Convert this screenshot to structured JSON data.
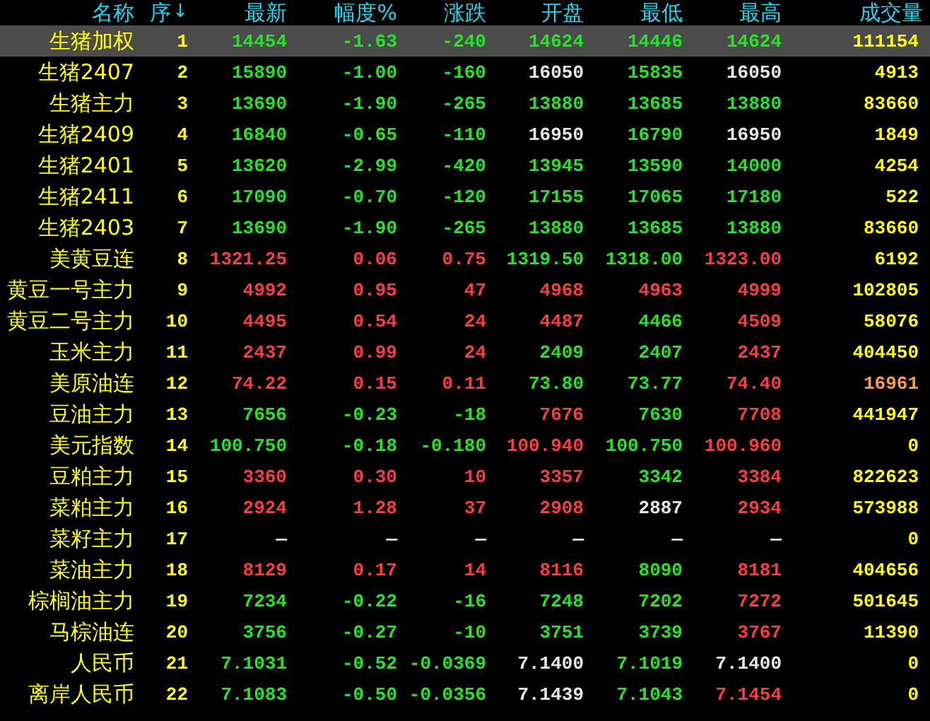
{
  "table": {
    "columns": [
      {
        "label": "名称"
      },
      {
        "label": "序",
        "sort_mark": "↓"
      },
      {
        "label": "最新"
      },
      {
        "label": "幅度%"
      },
      {
        "label": "涨跌"
      },
      {
        "label": "开盘"
      },
      {
        "label": "最低"
      },
      {
        "label": "最高"
      },
      {
        "label": "成交量"
      }
    ],
    "rows": [
      {
        "selected": true,
        "cells": [
          {
            "text": "生猪加权",
            "color": "#ffff00"
          },
          {
            "text": "1",
            "color": "#ffff00"
          },
          {
            "text": "14454",
            "color": "#22e622"
          },
          {
            "text": "-1.63",
            "color": "#22e622"
          },
          {
            "text": "-240",
            "color": "#22e622"
          },
          {
            "text": "14624",
            "color": "#22e622"
          },
          {
            "text": "14446",
            "color": "#22e622"
          },
          {
            "text": "14624",
            "color": "#22e622"
          },
          {
            "text": "111154",
            "color": "#ffff00"
          }
        ]
      },
      {
        "selected": false,
        "cells": [
          {
            "text": "生猪2407",
            "color": "#ffff00"
          },
          {
            "text": "2",
            "color": "#ffff00"
          },
          {
            "text": "15890",
            "color": "#22e622"
          },
          {
            "text": "-1.00",
            "color": "#22e622"
          },
          {
            "text": "-160",
            "color": "#22e622"
          },
          {
            "text": "16050",
            "color": "#e6e6e6"
          },
          {
            "text": "15835",
            "color": "#22e622"
          },
          {
            "text": "16050",
            "color": "#e6e6e6"
          },
          {
            "text": "4913",
            "color": "#ffff00"
          }
        ]
      },
      {
        "selected": false,
        "cells": [
          {
            "text": "生猪主力",
            "color": "#ffff00"
          },
          {
            "text": "3",
            "color": "#ffff00"
          },
          {
            "text": "13690",
            "color": "#22e622"
          },
          {
            "text": "-1.90",
            "color": "#22e622"
          },
          {
            "text": "-265",
            "color": "#22e622"
          },
          {
            "text": "13880",
            "color": "#22e622"
          },
          {
            "text": "13685",
            "color": "#22e622"
          },
          {
            "text": "13880",
            "color": "#22e622"
          },
          {
            "text": "83660",
            "color": "#ffff00"
          }
        ]
      },
      {
        "selected": false,
        "cells": [
          {
            "text": "生猪2409",
            "color": "#ffff00"
          },
          {
            "text": "4",
            "color": "#ffff00"
          },
          {
            "text": "16840",
            "color": "#22e622"
          },
          {
            "text": "-0.65",
            "color": "#22e622"
          },
          {
            "text": "-110",
            "color": "#22e622"
          },
          {
            "text": "16950",
            "color": "#e6e6e6"
          },
          {
            "text": "16790",
            "color": "#22e622"
          },
          {
            "text": "16950",
            "color": "#e6e6e6"
          },
          {
            "text": "1849",
            "color": "#ffff00"
          }
        ]
      },
      {
        "selected": false,
        "cells": [
          {
            "text": "生猪2401",
            "color": "#ffff00"
          },
          {
            "text": "5",
            "color": "#ffff00"
          },
          {
            "text": "13620",
            "color": "#22e622"
          },
          {
            "text": "-2.99",
            "color": "#22e622"
          },
          {
            "text": "-420",
            "color": "#22e622"
          },
          {
            "text": "13945",
            "color": "#22e622"
          },
          {
            "text": "13590",
            "color": "#22e622"
          },
          {
            "text": "14000",
            "color": "#22e622"
          },
          {
            "text": "4254",
            "color": "#ffff00"
          }
        ]
      },
      {
        "selected": false,
        "cells": [
          {
            "text": "生猪2411",
            "color": "#ffff00"
          },
          {
            "text": "6",
            "color": "#ffff00"
          },
          {
            "text": "17090",
            "color": "#22e622"
          },
          {
            "text": "-0.70",
            "color": "#22e622"
          },
          {
            "text": "-120",
            "color": "#22e622"
          },
          {
            "text": "17155",
            "color": "#22e622"
          },
          {
            "text": "17065",
            "color": "#22e622"
          },
          {
            "text": "17180",
            "color": "#22e622"
          },
          {
            "text": "522",
            "color": "#ffff00"
          }
        ]
      },
      {
        "selected": false,
        "cells": [
          {
            "text": "生猪2403",
            "color": "#ffff00"
          },
          {
            "text": "7",
            "color": "#ffff00"
          },
          {
            "text": "13690",
            "color": "#22e622"
          },
          {
            "text": "-1.90",
            "color": "#22e622"
          },
          {
            "text": "-265",
            "color": "#22e622"
          },
          {
            "text": "13880",
            "color": "#22e622"
          },
          {
            "text": "13685",
            "color": "#22e622"
          },
          {
            "text": "13880",
            "color": "#22e622"
          },
          {
            "text": "83660",
            "color": "#ffff00"
          }
        ]
      },
      {
        "selected": false,
        "cells": [
          {
            "text": "美黄豆连",
            "color": "#ffff00"
          },
          {
            "text": "8",
            "color": "#ffff00"
          },
          {
            "text": "1321.25",
            "color": "#ff3c3c"
          },
          {
            "text": "0.06",
            "color": "#ff3c3c"
          },
          {
            "text": "0.75",
            "color": "#ff3c3c"
          },
          {
            "text": "1319.50",
            "color": "#22e622"
          },
          {
            "text": "1318.00",
            "color": "#22e622"
          },
          {
            "text": "1323.00",
            "color": "#ff3c3c"
          },
          {
            "text": "6192",
            "color": "#ffff00"
          }
        ]
      },
      {
        "selected": false,
        "cells": [
          {
            "text": "黄豆一号主力",
            "color": "#ffff00"
          },
          {
            "text": "9",
            "color": "#ffff00"
          },
          {
            "text": "4992",
            "color": "#ff3c3c"
          },
          {
            "text": "0.95",
            "color": "#ff3c3c"
          },
          {
            "text": "47",
            "color": "#ff3c3c"
          },
          {
            "text": "4968",
            "color": "#ff3c3c"
          },
          {
            "text": "4963",
            "color": "#ff3c3c"
          },
          {
            "text": "4999",
            "color": "#ff3c3c"
          },
          {
            "text": "102805",
            "color": "#ffff00"
          }
        ]
      },
      {
        "selected": false,
        "cells": [
          {
            "text": "黄豆二号主力",
            "color": "#ffff00"
          },
          {
            "text": "10",
            "color": "#ffff00"
          },
          {
            "text": "4495",
            "color": "#ff3c3c"
          },
          {
            "text": "0.54",
            "color": "#ff3c3c"
          },
          {
            "text": "24",
            "color": "#ff3c3c"
          },
          {
            "text": "4487",
            "color": "#ff3c3c"
          },
          {
            "text": "4466",
            "color": "#22e622"
          },
          {
            "text": "4509",
            "color": "#ff3c3c"
          },
          {
            "text": "58076",
            "color": "#ffff00"
          }
        ]
      },
      {
        "selected": false,
        "cells": [
          {
            "text": "玉米主力",
            "color": "#ffff00"
          },
          {
            "text": "11",
            "color": "#ffff00"
          },
          {
            "text": "2437",
            "color": "#ff3c3c"
          },
          {
            "text": "0.99",
            "color": "#ff3c3c"
          },
          {
            "text": "24",
            "color": "#ff3c3c"
          },
          {
            "text": "2409",
            "color": "#22e622"
          },
          {
            "text": "2407",
            "color": "#22e622"
          },
          {
            "text": "2437",
            "color": "#ff3c3c"
          },
          {
            "text": "404450",
            "color": "#ffff00"
          }
        ]
      },
      {
        "selected": false,
        "cells": [
          {
            "text": "美原油连",
            "color": "#ffff00"
          },
          {
            "text": "12",
            "color": "#ffff00"
          },
          {
            "text": "74.22",
            "color": "#ff3c3c"
          },
          {
            "text": "0.15",
            "color": "#ff3c3c"
          },
          {
            "text": "0.11",
            "color": "#ff3c3c"
          },
          {
            "text": "73.80",
            "color": "#22e622"
          },
          {
            "text": "73.77",
            "color": "#22e622"
          },
          {
            "text": "74.40",
            "color": "#ff3c3c"
          },
          {
            "text": "16961",
            "color": "#ff9a4a"
          }
        ]
      },
      {
        "selected": false,
        "cells": [
          {
            "text": "豆油主力",
            "color": "#ffff00"
          },
          {
            "text": "13",
            "color": "#ffff00"
          },
          {
            "text": "7656",
            "color": "#22e622"
          },
          {
            "text": "-0.23",
            "color": "#22e622"
          },
          {
            "text": "-18",
            "color": "#22e622"
          },
          {
            "text": "7676",
            "color": "#ff3c3c"
          },
          {
            "text": "7630",
            "color": "#22e622"
          },
          {
            "text": "7708",
            "color": "#ff3c3c"
          },
          {
            "text": "441947",
            "color": "#ffff00"
          }
        ]
      },
      {
        "selected": false,
        "cells": [
          {
            "text": "美元指数",
            "color": "#ffff00"
          },
          {
            "text": "14",
            "color": "#ffff00"
          },
          {
            "text": "100.750",
            "color": "#22e622"
          },
          {
            "text": "-0.18",
            "color": "#22e622"
          },
          {
            "text": "-0.180",
            "color": "#22e622"
          },
          {
            "text": "100.940",
            "color": "#ff3c3c"
          },
          {
            "text": "100.750",
            "color": "#22e622"
          },
          {
            "text": "100.960",
            "color": "#ff3c3c"
          },
          {
            "text": "0",
            "color": "#ffff00"
          }
        ]
      },
      {
        "selected": false,
        "cells": [
          {
            "text": "豆粕主力",
            "color": "#ffff00"
          },
          {
            "text": "15",
            "color": "#ffff00"
          },
          {
            "text": "3360",
            "color": "#ff3c3c"
          },
          {
            "text": "0.30",
            "color": "#ff3c3c"
          },
          {
            "text": "10",
            "color": "#ff3c3c"
          },
          {
            "text": "3357",
            "color": "#ff3c3c"
          },
          {
            "text": "3342",
            "color": "#22e622"
          },
          {
            "text": "3384",
            "color": "#ff3c3c"
          },
          {
            "text": "822623",
            "color": "#ffff00"
          }
        ]
      },
      {
        "selected": false,
        "cells": [
          {
            "text": "菜粕主力",
            "color": "#ffff00"
          },
          {
            "text": "16",
            "color": "#ffff00"
          },
          {
            "text": "2924",
            "color": "#ff3c3c"
          },
          {
            "text": "1.28",
            "color": "#ff3c3c"
          },
          {
            "text": "37",
            "color": "#ff3c3c"
          },
          {
            "text": "2908",
            "color": "#ff3c3c"
          },
          {
            "text": "2887",
            "color": "#e6e6e6"
          },
          {
            "text": "2934",
            "color": "#ff3c3c"
          },
          {
            "text": "573988",
            "color": "#ffff00"
          }
        ]
      },
      {
        "selected": false,
        "cells": [
          {
            "text": "菜籽主力",
            "color": "#ffff00"
          },
          {
            "text": "17",
            "color": "#ffff00"
          },
          {
            "text": "—",
            "color": "#e6e6e6"
          },
          {
            "text": "—",
            "color": "#e6e6e6"
          },
          {
            "text": "—",
            "color": "#e6e6e6"
          },
          {
            "text": "—",
            "color": "#e6e6e6"
          },
          {
            "text": "—",
            "color": "#e6e6e6"
          },
          {
            "text": "—",
            "color": "#e6e6e6"
          },
          {
            "text": "0",
            "color": "#ffff00"
          }
        ]
      },
      {
        "selected": false,
        "cells": [
          {
            "text": "菜油主力",
            "color": "#ffff00"
          },
          {
            "text": "18",
            "color": "#ffff00"
          },
          {
            "text": "8129",
            "color": "#ff3c3c"
          },
          {
            "text": "0.17",
            "color": "#ff3c3c"
          },
          {
            "text": "14",
            "color": "#ff3c3c"
          },
          {
            "text": "8116",
            "color": "#ff3c3c"
          },
          {
            "text": "8090",
            "color": "#22e622"
          },
          {
            "text": "8181",
            "color": "#ff3c3c"
          },
          {
            "text": "404656",
            "color": "#ffff00"
          }
        ]
      },
      {
        "selected": false,
        "cells": [
          {
            "text": "棕榈油主力",
            "color": "#ffff00"
          },
          {
            "text": "19",
            "color": "#ffff00"
          },
          {
            "text": "7234",
            "color": "#22e622"
          },
          {
            "text": "-0.22",
            "color": "#22e622"
          },
          {
            "text": "-16",
            "color": "#22e622"
          },
          {
            "text": "7248",
            "color": "#22e622"
          },
          {
            "text": "7202",
            "color": "#22e622"
          },
          {
            "text": "7272",
            "color": "#ff3c3c"
          },
          {
            "text": "501645",
            "color": "#ffff00"
          }
        ]
      },
      {
        "selected": false,
        "cells": [
          {
            "text": "马棕油连",
            "color": "#ffff00"
          },
          {
            "text": "20",
            "color": "#ffff00"
          },
          {
            "text": "3756",
            "color": "#22e622"
          },
          {
            "text": "-0.27",
            "color": "#22e622"
          },
          {
            "text": "-10",
            "color": "#22e622"
          },
          {
            "text": "3751",
            "color": "#22e622"
          },
          {
            "text": "3739",
            "color": "#22e622"
          },
          {
            "text": "3767",
            "color": "#ff3c3c"
          },
          {
            "text": "11390",
            "color": "#ffff00"
          }
        ]
      },
      {
        "selected": false,
        "cells": [
          {
            "text": "人民币",
            "color": "#ffff00"
          },
          {
            "text": "21",
            "color": "#ffff00"
          },
          {
            "text": "7.1031",
            "color": "#22e622"
          },
          {
            "text": "-0.52",
            "color": "#22e622"
          },
          {
            "text": "-0.0369",
            "color": "#22e622"
          },
          {
            "text": "7.1400",
            "color": "#e6e6e6"
          },
          {
            "text": "7.1019",
            "color": "#22e622"
          },
          {
            "text": "7.1400",
            "color": "#e6e6e6"
          },
          {
            "text": "0",
            "color": "#ffff00"
          }
        ]
      },
      {
        "selected": false,
        "cells": [
          {
            "text": "离岸人民币",
            "color": "#ffff00"
          },
          {
            "text": "22",
            "color": "#ffff00"
          },
          {
            "text": "7.1083",
            "color": "#22e622"
          },
          {
            "text": "-0.50",
            "color": "#22e622"
          },
          {
            "text": "-0.0356",
            "color": "#22e622"
          },
          {
            "text": "7.1439",
            "color": "#e6e6e6"
          },
          {
            "text": "7.1043",
            "color": "#22e622"
          },
          {
            "text": "7.1454",
            "color": "#ff3c3c"
          },
          {
            "text": "0",
            "color": "#ffff00"
          }
        ]
      }
    ]
  }
}
